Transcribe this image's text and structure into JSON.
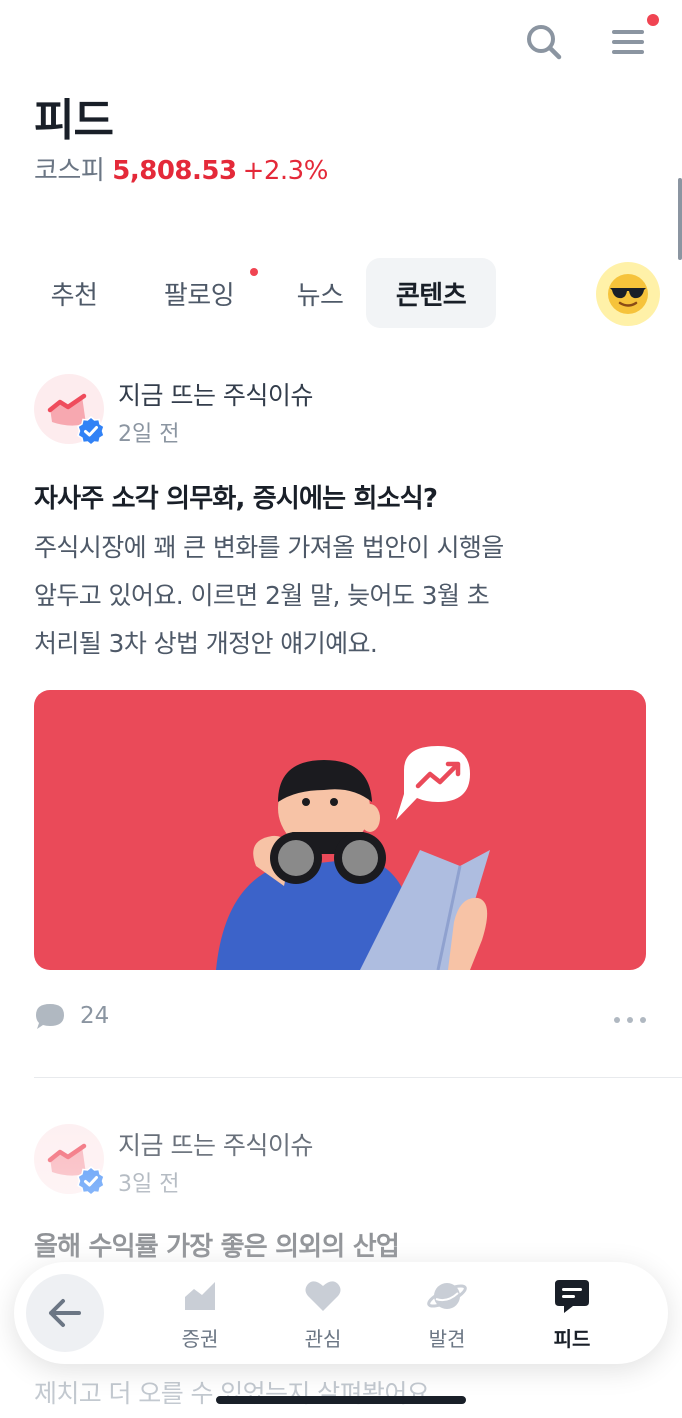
{
  "header": {
    "title": "피드",
    "search_icon": "search-icon",
    "menu_icon": "menu-icon",
    "menu_has_notification": true
  },
  "market": {
    "label": "코스피",
    "value": "5,808.53",
    "change": "+2.3%",
    "color": "#e42939"
  },
  "tabs": [
    {
      "label": "추천",
      "active": false
    },
    {
      "label": "팔로잉",
      "active": false,
      "has_dot": true
    },
    {
      "label": "뉴스",
      "active": false
    },
    {
      "label": "콘텐츠",
      "active": true
    }
  ],
  "profile_icon": "sunglasses-emoji-icon",
  "posts": [
    {
      "author": "지금 뜨는 주식이슈",
      "time": "2일 전",
      "title": "자사주 소각 의무화, 증시에는 희소식?",
      "body_lines": [
        "주식시장에 꽤 큰 변화를 가져올 법안이 시행을",
        "앞두고 있어요. 이르면 2월 말, 늦어도 3월 초",
        "처리될 3차 상법 개정안 얘기예요."
      ],
      "comments": "24",
      "image_bg": "#ea4a59"
    },
    {
      "author": "지금 뜨는 주식이슈",
      "time": "3일 전",
      "title": "올해 수익률 가장 좋은 의외의 산업",
      "body_peek": "제치고 더 오를 수 있었는지 살펴봤어요."
    }
  ],
  "bottom_nav": {
    "back_icon": "arrow-left-icon",
    "items": [
      {
        "label": "증권",
        "icon": "chart-icon",
        "active": false
      },
      {
        "label": "관심",
        "icon": "heart-icon",
        "active": false
      },
      {
        "label": "발견",
        "icon": "planet-icon",
        "active": false
      },
      {
        "label": "피드",
        "icon": "chat-bubble-icon",
        "active": true
      }
    ]
  },
  "accent_color": "#f04452"
}
